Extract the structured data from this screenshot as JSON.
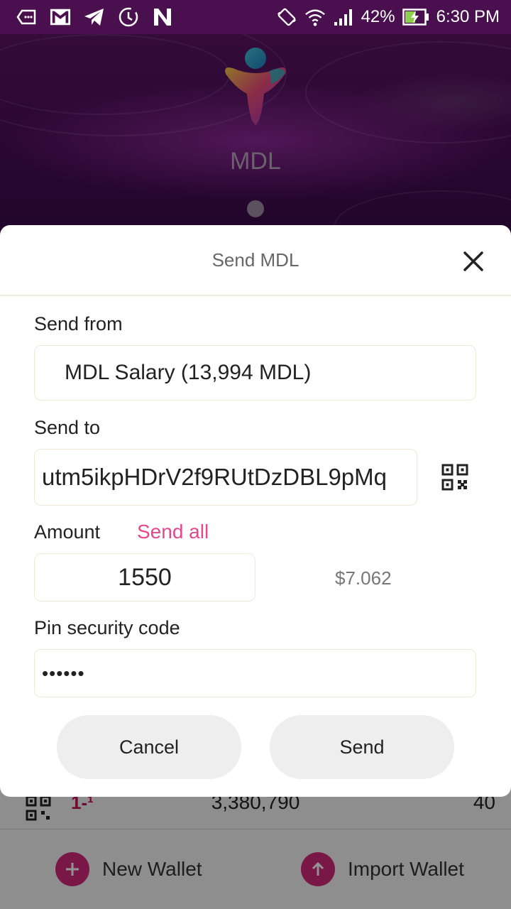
{
  "status_bar": {
    "battery": "42%",
    "time": "6:30 PM"
  },
  "header": {
    "coin_name": "MDL"
  },
  "modal": {
    "title": "Send MDL",
    "send_from": {
      "label": "Send from",
      "value": "MDL Salary (13,994 MDL)"
    },
    "send_to": {
      "label": "Send to",
      "value": "utm5ikpHDrV2f9RUtDzDBL9pMq"
    },
    "amount": {
      "label": "Amount",
      "send_all_label": "Send all",
      "value": "1550",
      "usd_value": "$7.062"
    },
    "pin": {
      "label": "Pin security code",
      "value": "••••••"
    },
    "buttons": {
      "cancel": "Cancel",
      "send": "Send"
    }
  },
  "background": {
    "wallet_row": {
      "index": "1-¹",
      "total": "3,380,790",
      "count": "40"
    },
    "actions": {
      "new_wallet": "New Wallet",
      "import_wallet": "Import Wallet"
    }
  },
  "colors": {
    "accent": "#e4488d",
    "header_bg": "#4a0e57",
    "action_circle": "#d12a7a"
  }
}
